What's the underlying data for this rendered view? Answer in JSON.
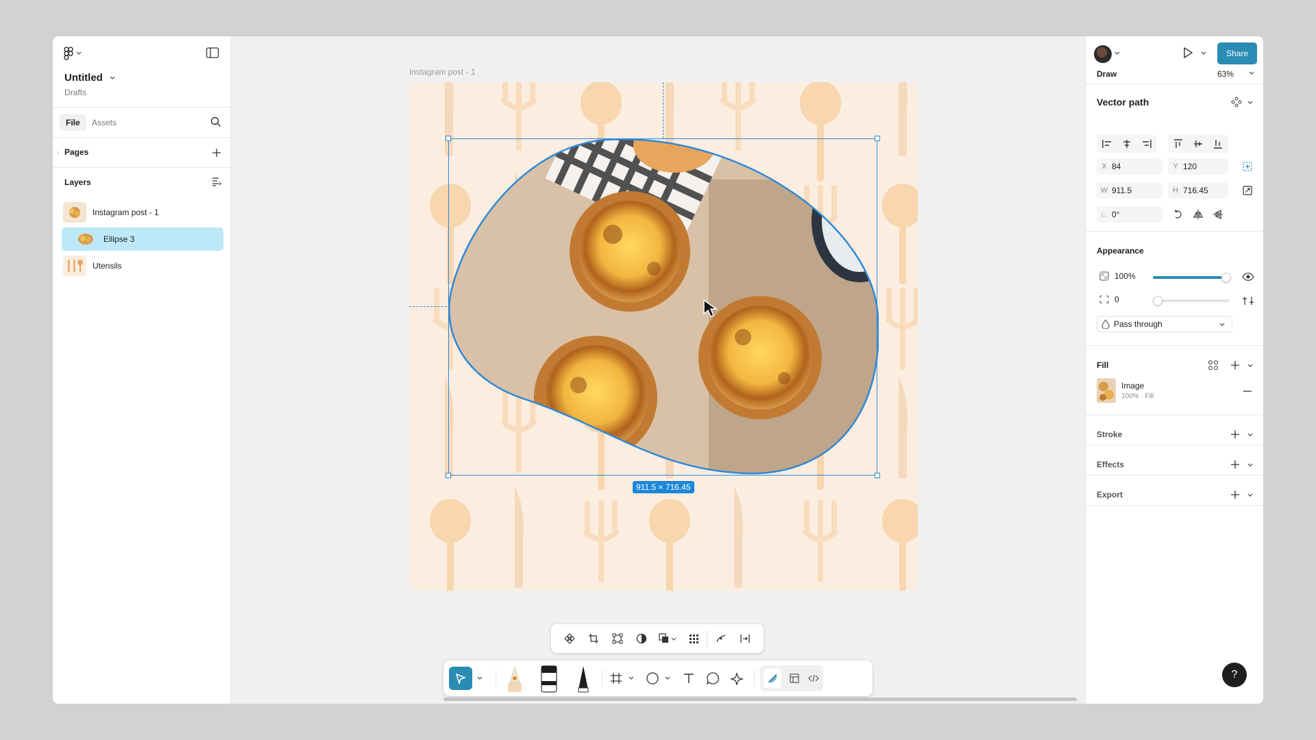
{
  "file": {
    "title": "Untitled",
    "location": "Drafts"
  },
  "left_tabs": {
    "file": "File",
    "assets": "Assets"
  },
  "pages_label": "Pages",
  "layers_label": "Layers",
  "layers": [
    {
      "name": "Instagram post - 1"
    },
    {
      "name": "Ellipse 3",
      "selected": true
    },
    {
      "name": "Utensils"
    }
  ],
  "canvas": {
    "frame_label": "Instagram post - 1",
    "selection_size": "911.5 × 716.45"
  },
  "header": {
    "share_label": "Share",
    "mode_label": "Draw",
    "zoom": "63%"
  },
  "vector": {
    "title": "Vector path",
    "x_label": "X",
    "x": "84",
    "y_label": "Y",
    "y": "120",
    "w_label": "W",
    "w": "911.5",
    "h_label": "H",
    "h": "716.45",
    "rotation": "0°"
  },
  "appearance": {
    "title": "Appearance",
    "opacity": "100%",
    "opacity_fraction": 1.0,
    "corner_radius": "0",
    "blend_mode": "Pass through"
  },
  "fill": {
    "title": "Fill",
    "type": "Image",
    "detail": "100% · Fill"
  },
  "stroke_title": "Stroke",
  "effects_title": "Effects",
  "export_title": "Export",
  "help_label": "?"
}
